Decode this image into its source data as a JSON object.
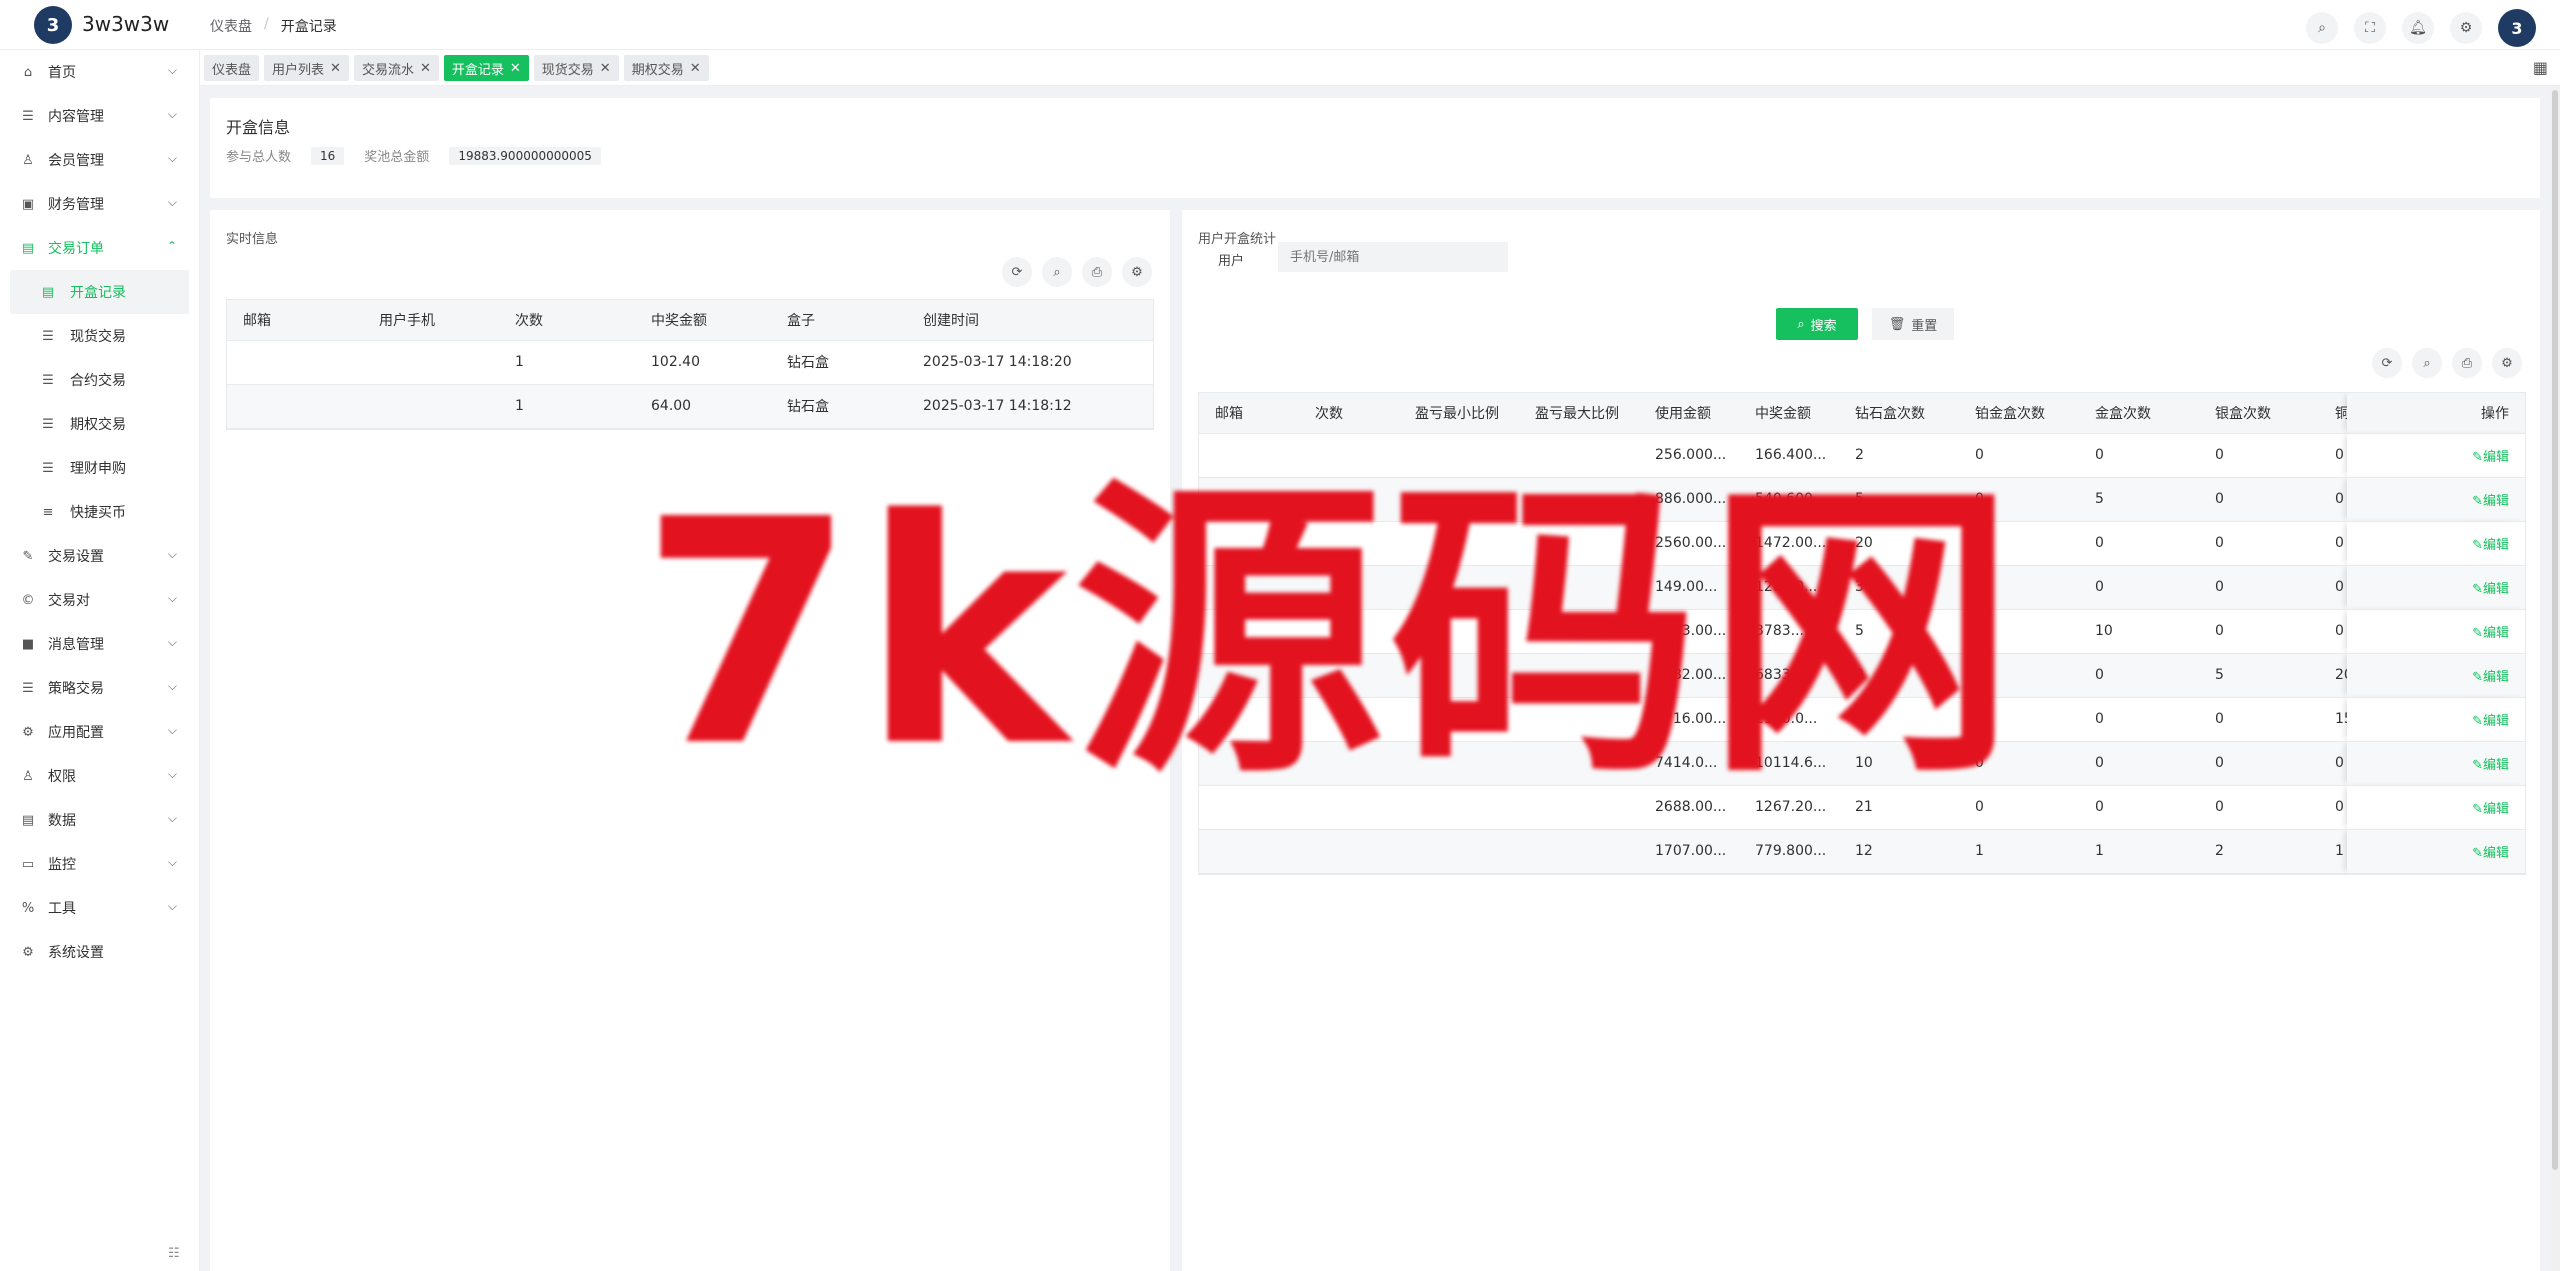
{
  "header": {
    "brand": "3w3w3w",
    "logo_text": "3",
    "breadcrumb": [
      "仪表盘",
      "/",
      "开盒记录"
    ],
    "icons": [
      "search-icon",
      "fullscreen-icon",
      "bell-icon",
      "gear-icon"
    ]
  },
  "sidebar": {
    "items": [
      {
        "label": "首页",
        "icon": "⌂"
      },
      {
        "label": "内容管理",
        "icon": "☰"
      },
      {
        "label": "会员管理",
        "icon": "♙"
      },
      {
        "label": "财务管理",
        "icon": "▣"
      },
      {
        "label": "交易订单",
        "icon": "▤"
      },
      {
        "label": "交易设置",
        "icon": "✎"
      },
      {
        "label": "交易对",
        "icon": "©"
      },
      {
        "label": "消息管理",
        "icon": "■"
      },
      {
        "label": "策略交易",
        "icon": "☰"
      },
      {
        "label": "应用配置",
        "icon": "⚙"
      },
      {
        "label": "权限",
        "icon": "♙"
      },
      {
        "label": "数据",
        "icon": "▤"
      },
      {
        "label": "监控",
        "icon": "▭"
      },
      {
        "label": "工具",
        "icon": "%"
      },
      {
        "label": "系统设置",
        "icon": "⚙"
      }
    ],
    "sub_items": [
      {
        "label": "开盒记录",
        "icon": "▤"
      },
      {
        "label": "现货交易",
        "icon": "☰"
      },
      {
        "label": "合约交易",
        "icon": "☰"
      },
      {
        "label": "期权交易",
        "icon": "☰"
      },
      {
        "label": "理财申购",
        "icon": "☰"
      },
      {
        "label": "快捷买币",
        "icon": "≡"
      }
    ]
  },
  "tabs": [
    {
      "label": "仪表盘",
      "closable": false
    },
    {
      "label": "用户列表",
      "closable": true
    },
    {
      "label": "交易流水",
      "closable": true
    },
    {
      "label": "开盒记录",
      "closable": true
    },
    {
      "label": "现货交易",
      "closable": true
    },
    {
      "label": "期权交易",
      "closable": true
    }
  ],
  "info": {
    "title": "开盒信息",
    "participants_label": "参与总人数",
    "participants_value": "16",
    "pool_label": "奖池总金额",
    "pool_value": "19883.900000000005"
  },
  "realtime": {
    "title": "实时信息",
    "columns": [
      "邮箱",
      "用户手机",
      "次数",
      "中奖金额",
      "盒子",
      "创建时间"
    ],
    "rows": [
      [
        "",
        "",
        "1",
        "102.40",
        "钻石盒",
        "2025-03-17 14:18:20"
      ],
      [
        "",
        "",
        "1",
        "64.00",
        "钻石盒",
        "2025-03-17 14:18:12"
      ]
    ]
  },
  "stats": {
    "title": "用户开盒统计",
    "user_label": "用户",
    "user_placeholder": "手机号/邮箱",
    "search_label": "搜索",
    "reset_label": "重置",
    "columns": [
      "邮箱",
      "次数",
      "盈亏最小比例",
      "盈亏最大比例",
      "使用金额",
      "中奖金额",
      "钻石盒次数",
      "铂金盒次数",
      "金盒次数",
      "银盒次数",
      "铜盒",
      "操作"
    ],
    "edit_label": "编辑",
    "rows": [
      [
        "",
        "",
        "",
        "",
        "256.000...",
        "166.400...",
        "2",
        "0",
        "0",
        "0",
        "0"
      ],
      [
        "",
        "",
        "",
        "",
        "886.000...",
        "540.600...",
        "5",
        "0",
        "5",
        "0",
        "0"
      ],
      [
        "",
        "",
        "",
        "",
        "2560.00...",
        "1472.00...",
        "20",
        "0",
        "0",
        "0",
        "0"
      ],
      [
        "",
        "",
        "",
        "",
        "149.00...",
        "128.00...",
        "3",
        "3",
        "0",
        "0",
        "0"
      ],
      [
        "",
        "",
        "",
        "",
        "2233.00...",
        "3783...",
        "5",
        "5",
        "10",
        "0",
        "0"
      ],
      [
        "",
        "",
        "",
        "",
        "2282.00...",
        "6833...",
        "9",
        "0",
        "0",
        "5",
        "20"
      ],
      [
        "",
        "",
        "",
        "",
        "3716.00...",
        "2150.0...",
        "20",
        "5",
        "0",
        "0",
        "15"
      ],
      [
        "",
        "",
        "",
        "",
        "7414.0...",
        "10114.6...",
        "10",
        "0",
        "0",
        "0",
        "0"
      ],
      [
        "",
        "",
        "",
        "",
        "2688.00...",
        "1267.20...",
        "21",
        "0",
        "0",
        "0",
        "0"
      ],
      [
        "",
        "",
        "",
        "",
        "1707.00...",
        "779.800...",
        "12",
        "1",
        "1",
        "2",
        "1"
      ]
    ]
  },
  "watermark": "7k源码网",
  "colors": {
    "accent": "#16c05f",
    "watermark": "#e3121f"
  }
}
